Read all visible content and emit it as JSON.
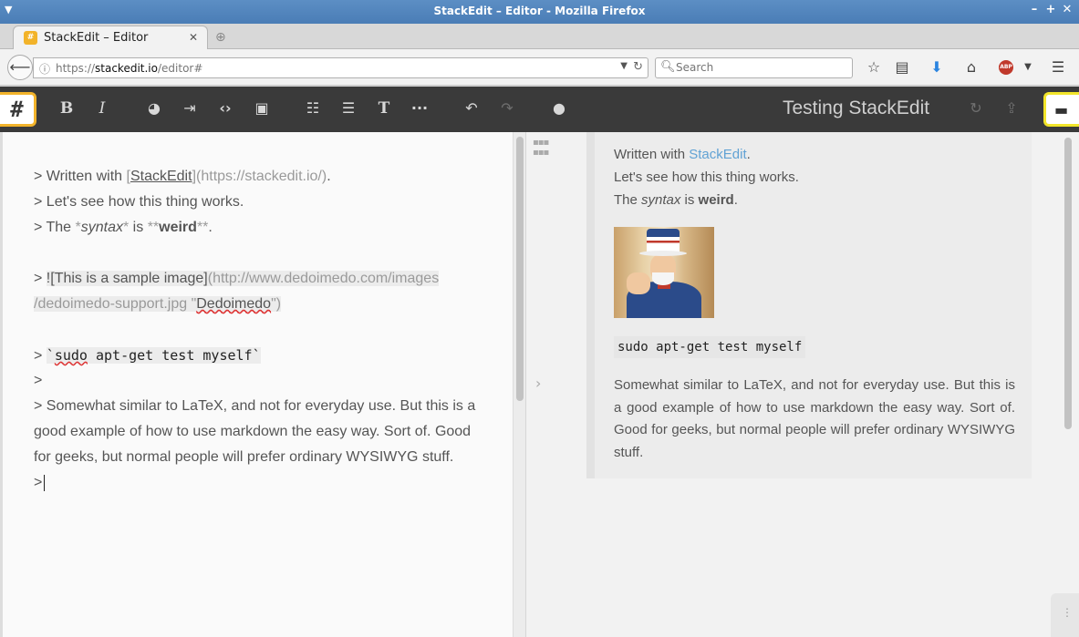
{
  "window": {
    "title": "StackEdit – Editor - Mozilla Firefox",
    "minimize": "–",
    "maximize": "+",
    "close": "✕"
  },
  "browser": {
    "tab_title": "StackEdit – Editor",
    "tab_favicon": "#",
    "url_scheme": "https://",
    "url_host": "stackedit.io",
    "url_path": "/editor#",
    "search_placeholder": "Search",
    "abp_label": "ABP"
  },
  "app": {
    "logo": "#",
    "document_title": "Testing StackEdit",
    "toolbar": {
      "bold": "B",
      "italic": "I",
      "heading": "T",
      "more": "···"
    }
  },
  "editor": {
    "line1_prefix": "> Written with ",
    "line1_link_open": "[",
    "line1_link_text": "StackEdit",
    "line1_link_close": "]",
    "line1_url": "(https://stackedit.io/)",
    "line1_end": ".",
    "line2": "> Let's see how this thing works.",
    "line3_prefix": "> The ",
    "line3_em_open": "*",
    "line3_em": "syntax",
    "line3_em_close": "*",
    "line3_mid": " is ",
    "line3_strong_open": "**",
    "line3_strong": "weird",
    "line3_strong_close": "**",
    "line3_end": ".",
    "image_prefix": "> ",
    "image_alt": "![This is a sample image]",
    "image_url_part1": "(http://www.dedoimedo.com/images",
    "image_url_part2": "/dedoimedo-support.jpg ",
    "image_title_open": "\"",
    "image_title": "Dedoimedo",
    "image_title_close": "\")",
    "code_prefix": "> ",
    "code_tick_open": "`",
    "code_word1": "sudo",
    "code_rest": " apt-get test myself",
    "code_tick_close": "`",
    "empty_quote": ">",
    "paragraph": "> Somewhat similar to LaTeX, and not for everyday use. But this is a good example of how to use markdown the easy way. Sort of. Good for geeks, but normal people will prefer ordinary WYSIWYG stuff.",
    "last_line": ">"
  },
  "preview": {
    "line1_prefix": "Written with ",
    "line1_link": "StackEdit",
    "line1_end": ".",
    "line2": "Let's see how this thing works.",
    "line3_prefix": "The ",
    "line3_em": "syntax",
    "line3_mid": " is ",
    "line3_strong": "weird",
    "line3_end": ".",
    "code": "sudo apt-get test myself",
    "paragraph": "Somewhat similar to LaTeX, and not for everyday use. But this is a good example of how to use markdown the easy way. Sort of. Good for geeks, but normal people will prefer ordinary WYSIWYG stuff."
  }
}
